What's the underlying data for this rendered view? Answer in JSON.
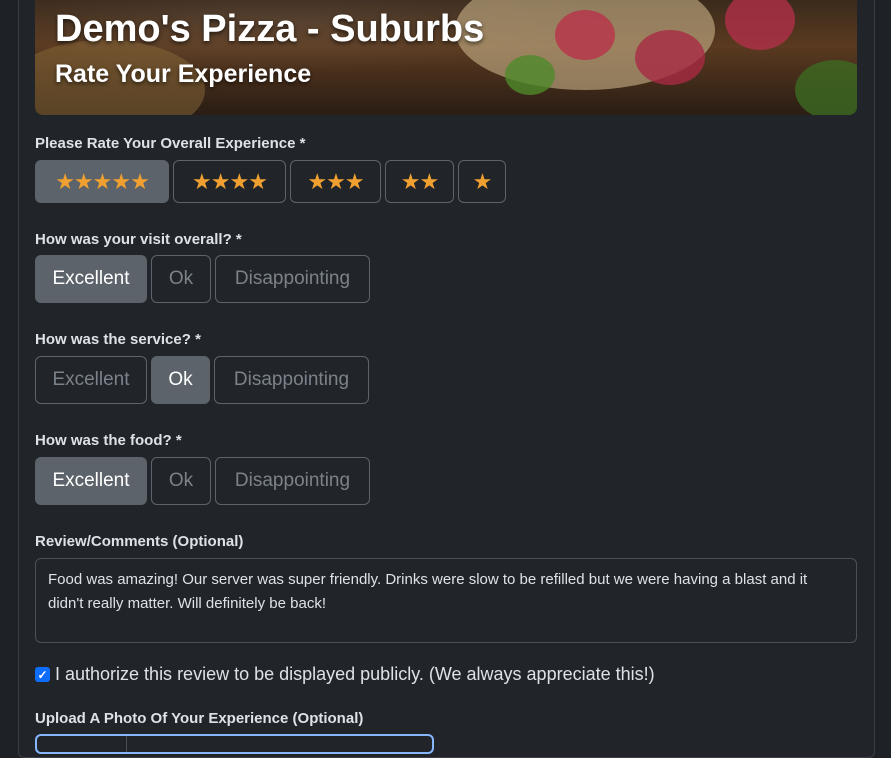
{
  "header": {
    "title": "Demo's Pizza - Suburbs",
    "subtitle": "Rate Your Experience"
  },
  "overall_rating": {
    "label": "Please Rate Your Overall Experience *",
    "options": [
      "★★★★★",
      "★★★★",
      "★★★",
      "★★",
      "★"
    ],
    "selected_stars": 5
  },
  "visit": {
    "label": "How was your visit overall? *",
    "options": [
      "Excellent",
      "Ok",
      "Disappointing"
    ],
    "selected": "Excellent"
  },
  "service": {
    "label": "How was the service? *",
    "options": [
      "Excellent",
      "Ok",
      "Disappointing"
    ],
    "selected": "Ok"
  },
  "food": {
    "label": "How was the food? *",
    "options": [
      "Excellent",
      "Ok",
      "Disappointing"
    ],
    "selected": "Excellent"
  },
  "review": {
    "label": "Review/Comments (Optional)",
    "value": "Food was amazing! Our server was super friendly. Drinks were slow to be refilled but we were having a blast and it didn't really matter. Will definitely be back!"
  },
  "authorize": {
    "checked": true,
    "label": "I authorize this review to be displayed publicly. (We always appreciate this!)"
  },
  "upload": {
    "label": "Upload A Photo Of Your Experience (Optional)"
  },
  "colors": {
    "star": "#f0a030",
    "selected_button": "#5c636a",
    "checkbox": "#0d6efd"
  }
}
